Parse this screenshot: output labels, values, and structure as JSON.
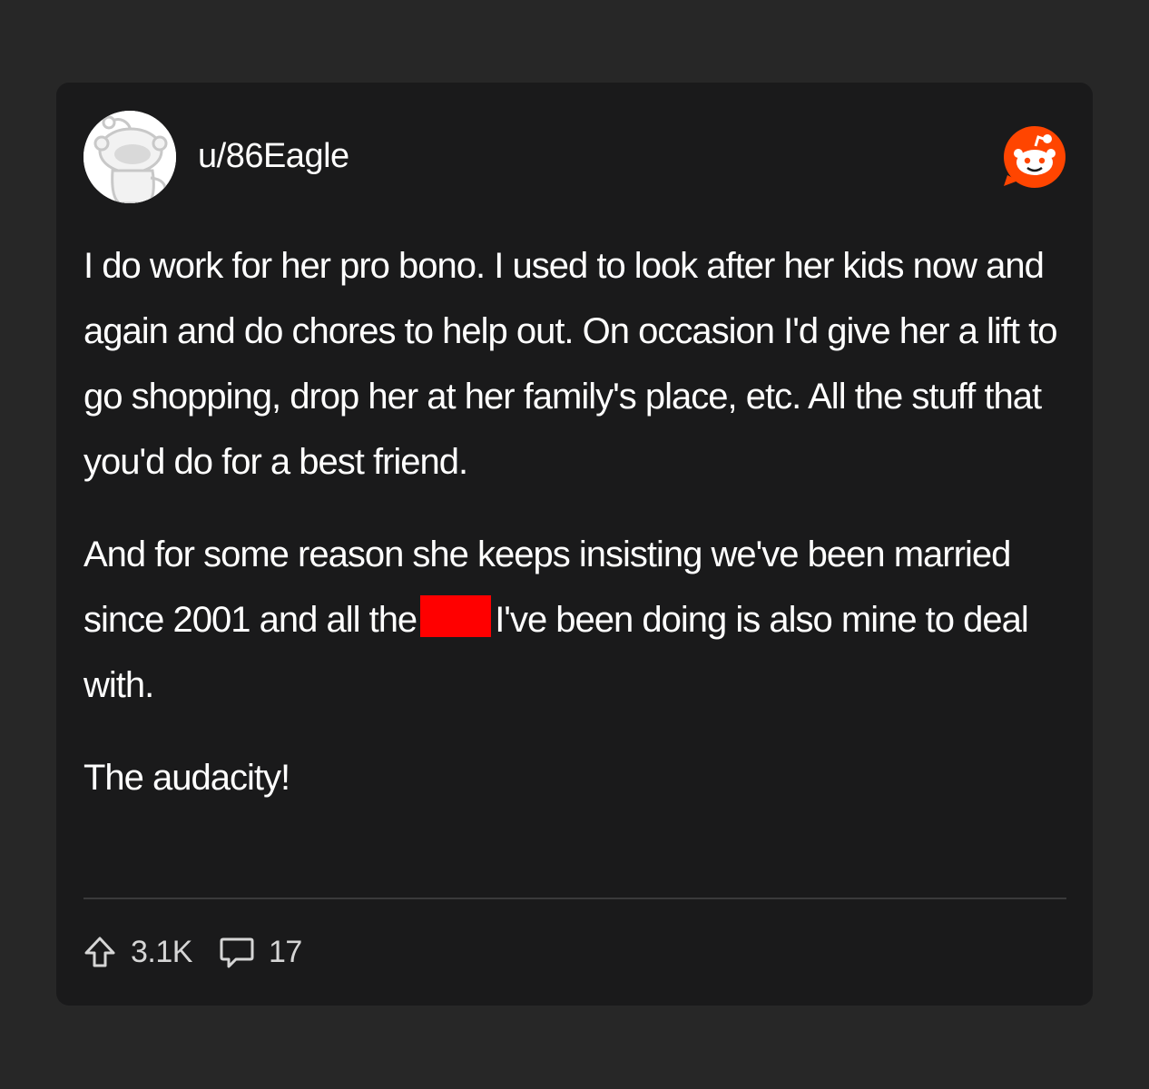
{
  "post": {
    "username": "u/86Eagle",
    "paragraphs": {
      "p1": "I do work for her pro bono. I used to look after her kids now and again and do chores to help out. On occasion I'd give her a lift to go shopping, drop her at her family's place, etc. All the stuff that you'd do for a best friend.",
      "p2_before": "And for some reason she keeps insisting we've been married since 2001 and all the",
      "p2_after": "I've been doing is also mine to deal with.",
      "p3": "The audacity!"
    },
    "redaction_color": "#ff0000"
  },
  "stats": {
    "upvotes": "3.1K",
    "comments": "17"
  },
  "icons": {
    "avatar": "snoo-avatar",
    "brand": "reddit-logo-icon",
    "upvote": "upvote-arrow-icon",
    "comment": "comment-bubble-icon"
  },
  "colors": {
    "page_background": "#272727",
    "card_background": "#1a1a1b",
    "text": "#ffffff",
    "brand_orange": "#ff4500"
  }
}
